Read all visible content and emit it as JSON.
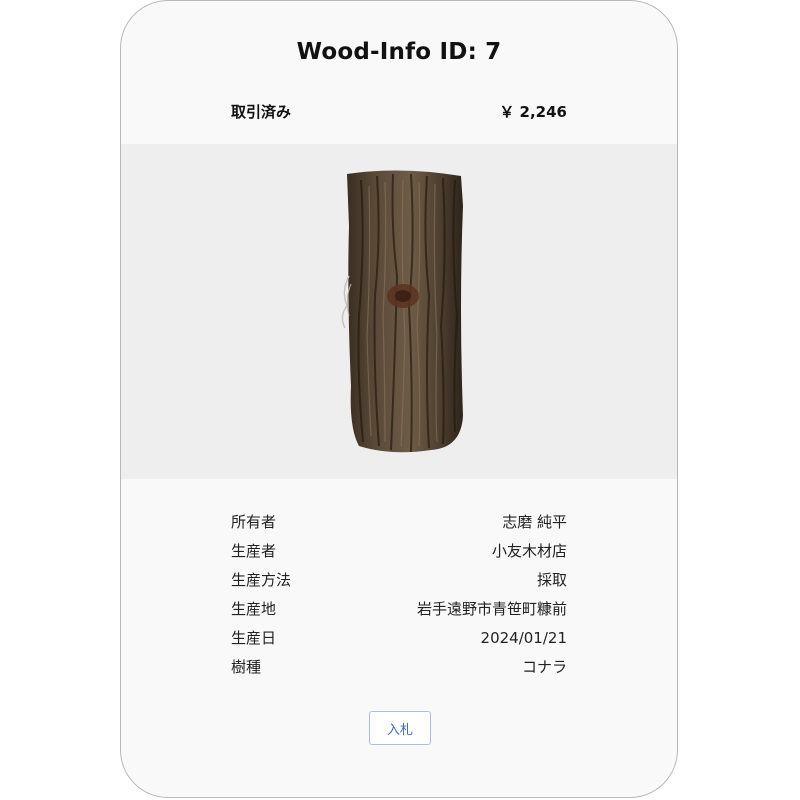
{
  "title": "Wood-Info ID: 7",
  "status": {
    "label": "取引済み",
    "price": "￥ 2,246"
  },
  "image": {
    "subject": "wood-log"
  },
  "details": [
    {
      "label": "所有者",
      "value": "志磨 純平"
    },
    {
      "label": "生産者",
      "value": "小友木材店"
    },
    {
      "label": "生産方法",
      "value": "採取"
    },
    {
      "label": "生産地",
      "value": "岩手遠野市青笹町糠前"
    },
    {
      "label": "生産日",
      "value": "2024/01/21"
    },
    {
      "label": "樹種",
      "value": "コナラ"
    }
  ],
  "actions": {
    "bid_label": "入札"
  },
  "colors": {
    "card_background": "#f9f9f9",
    "image_background": "#eeeeee",
    "button_text": "#3f6db3",
    "button_border": "#a9c0df"
  }
}
